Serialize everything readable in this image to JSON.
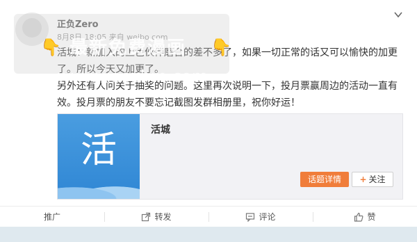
{
  "post": {
    "username": "正负Zero",
    "meta": "8月8日 18:05 来自 weibo.com",
    "paragraphs": [
      "活城：新加入的上色伙伴磨合的差不多了，如果一切正常的话又可以愉快的加更了。所以今天又加更了。",
      "另外还有人问关于抽奖的问题。这里再次说明一下，投月票赢周边的活动一直有效。投月票的朋友不要忘记截图发群相册里，祝你好运！"
    ]
  },
  "watermark": {
    "text": "最新免费漫画",
    "url": "www.jiaozhm.com"
  },
  "share_card": {
    "thumb_char": "活",
    "title": "活城",
    "detail_label": "话题详情",
    "follow_label": "关注"
  },
  "actions": [
    {
      "label": "推广",
      "icon": "none"
    },
    {
      "label": "转发",
      "icon": "share-icon"
    },
    {
      "label": "评论",
      "icon": "comment-icon"
    },
    {
      "label": "赞",
      "icon": "like-icon"
    }
  ],
  "colors": {
    "accent": "#f07d3a",
    "thumb": "#3a92db",
    "footer_bg": "#dfe9ef"
  }
}
